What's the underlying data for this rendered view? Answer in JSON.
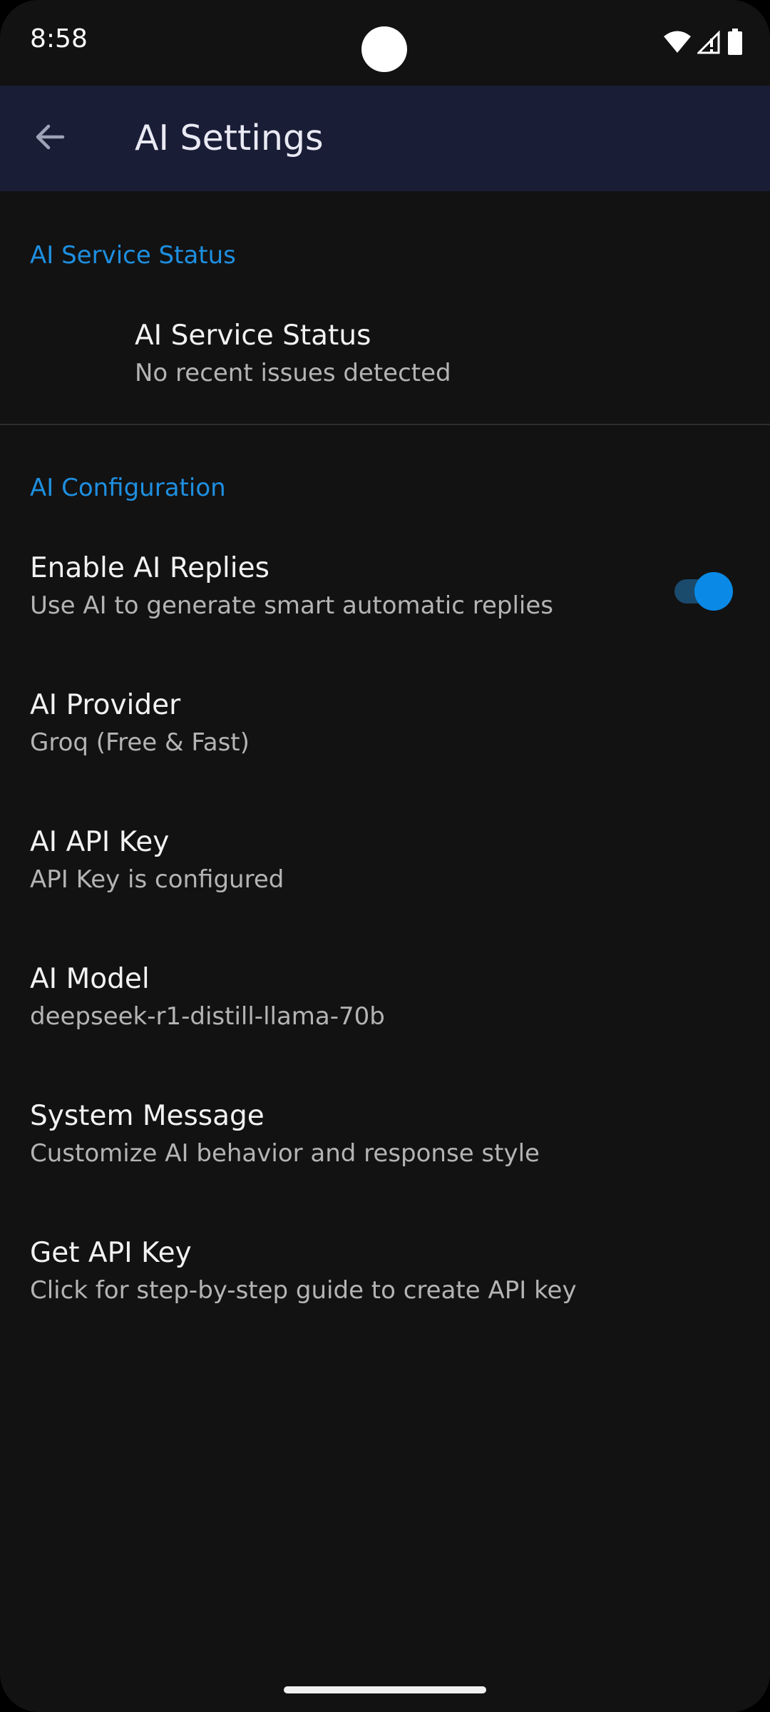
{
  "status_bar": {
    "time": "8:58"
  },
  "app_bar": {
    "back_icon": "arrow-back-icon",
    "title": "AI Settings"
  },
  "colors": {
    "accent": "#1e8fe0",
    "app_bar_bg": "#1a1d36",
    "background": "#121212",
    "switch_on": "#0a8ae6"
  },
  "sections": [
    {
      "header": "AI Service Status",
      "items": [
        {
          "title": "AI Service Status",
          "summary": "No recent issues detected"
        }
      ]
    },
    {
      "header": "AI Configuration",
      "items": [
        {
          "title": "Enable AI Replies",
          "summary": "Use AI to generate smart automatic replies",
          "toggle_on": true
        },
        {
          "title": "AI Provider",
          "summary": "Groq (Free & Fast)"
        },
        {
          "title": "AI API Key",
          "summary": "API Key is configured"
        },
        {
          "title": "AI Model",
          "summary": "deepseek-r1-distill-llama-70b"
        },
        {
          "title": "System Message",
          "summary": "Customize AI behavior and response style"
        },
        {
          "title": "Get API Key",
          "summary": "Click for step-by-step guide to create API key"
        }
      ]
    }
  ]
}
